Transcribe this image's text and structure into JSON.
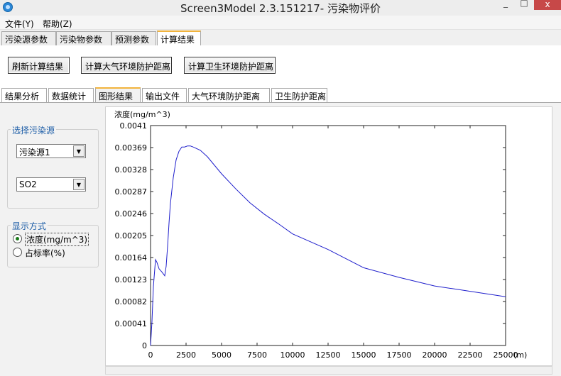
{
  "window": {
    "title": "Screen3Model 2.3.151217- 污染物评价"
  },
  "menu": {
    "items": [
      "文件(Y)",
      "帮助(Z)"
    ]
  },
  "top_tabs": [
    "污染源参数",
    "污染物参数",
    "预测参数",
    "计算结果"
  ],
  "top_active": "计算结果",
  "buttons": {
    "refresh": "刷新计算结果",
    "air_distance": "计算大气环境防护距离",
    "hygiene_distance": "计算卫生环境防护距离"
  },
  "sub_tabs": [
    "结果分析",
    "数据统计",
    "图形结果",
    "输出文件",
    "大气环境防护距离",
    "卫生防护距离"
  ],
  "sub_active": "图形结果",
  "source_group": {
    "legend": "选择污染源",
    "source_value": "污染源1",
    "pollutant_value": "SO2"
  },
  "display_group": {
    "legend": "显示方式",
    "options": [
      "浓度(mg/m^3)",
      "占标率(%)"
    ],
    "selected": "浓度(mg/m^3)"
  },
  "chart_data": {
    "type": "line",
    "ylabel": "浓度(mg/m^3)",
    "xlabel": "(m)",
    "xlim": [
      0,
      25000
    ],
    "ylim": [
      0,
      0.0041
    ],
    "x_ticks": [
      "0",
      "2500",
      "5000",
      "7500",
      "10000",
      "12500",
      "15000",
      "17500",
      "20000",
      "22500",
      "25000"
    ],
    "y_ticks": [
      "0",
      "0.00041",
      "0.00082",
      "0.00123",
      "0.00164",
      "0.00205",
      "0.00246",
      "0.00287",
      "0.00328",
      "0.00369",
      "0.0041"
    ],
    "grid": false,
    "series_color": "#1f1fcc",
    "x": [
      0,
      100,
      200,
      350,
      450,
      600,
      800,
      1000,
      1100,
      1200,
      1300,
      1400,
      1600,
      1800,
      2000,
      2200,
      2400,
      2600,
      2800,
      3000,
      3500,
      4000,
      5000,
      6000,
      7000,
      8000,
      9000,
      10000,
      12500,
      15000,
      17500,
      20000,
      22500,
      25000
    ],
    "y": [
      0,
      0.00045,
      0.0011,
      0.0016,
      0.00155,
      0.00143,
      0.00137,
      0.0013,
      0.00148,
      0.00185,
      0.00228,
      0.00265,
      0.00313,
      0.00346,
      0.00362,
      0.0037,
      0.0037,
      0.00372,
      0.00372,
      0.0037,
      0.00364,
      0.00352,
      0.0032,
      0.00292,
      0.00266,
      0.00245,
      0.00227,
      0.00208,
      0.00179,
      0.00145,
      0.00127,
      0.00111,
      0.00101,
      0.00091
    ]
  }
}
